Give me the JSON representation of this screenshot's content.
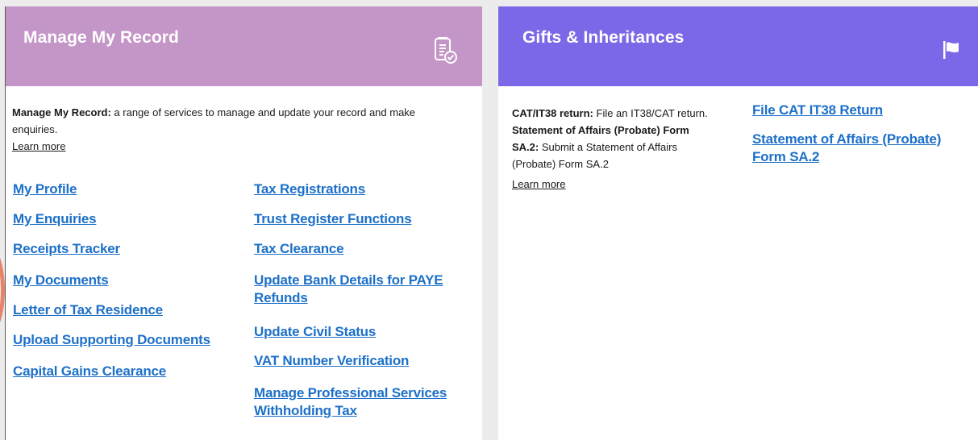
{
  "left_card": {
    "title": "Manage My Record",
    "icon": "document-check-icon",
    "desc_strong": "Manage My Record:",
    "desc_rest": " a range of services to manage and update your record and make enquiries.",
    "learn_more": "Learn more",
    "links_col1": [
      "My Profile",
      "My Enquiries",
      "Receipts Tracker",
      "My Documents",
      "Letter of Tax Residence",
      "Upload Supporting Documents",
      "Capital Gains Clearance"
    ],
    "links_col2": [
      "Tax Registrations",
      "Trust Register Functions",
      "Tax Clearance",
      "Update Bank Details for PAYE Refunds",
      "Update Civil Status",
      "VAT Number Verification",
      "Manage Professional Services Withholding Tax"
    ]
  },
  "right_card": {
    "title": "Gifts & Inheritances",
    "icon": "flag-icon",
    "desc1_strong": "CAT/IT38 return:",
    "desc1_rest": " File an IT38/CAT return.",
    "desc2_strong": "Statement of Affairs (Probate) Form SA.2:",
    "desc2_rest": " Submit a Statement of Affairs (Probate) Form SA.2",
    "learn_more": "Learn more",
    "links": [
      "File CAT IT38 Return",
      "Statement of Affairs (Probate) Form SA.2"
    ]
  },
  "colors": {
    "left_header": "#c495c7",
    "right_header": "#7b68e8",
    "link": "#1d70c8"
  }
}
